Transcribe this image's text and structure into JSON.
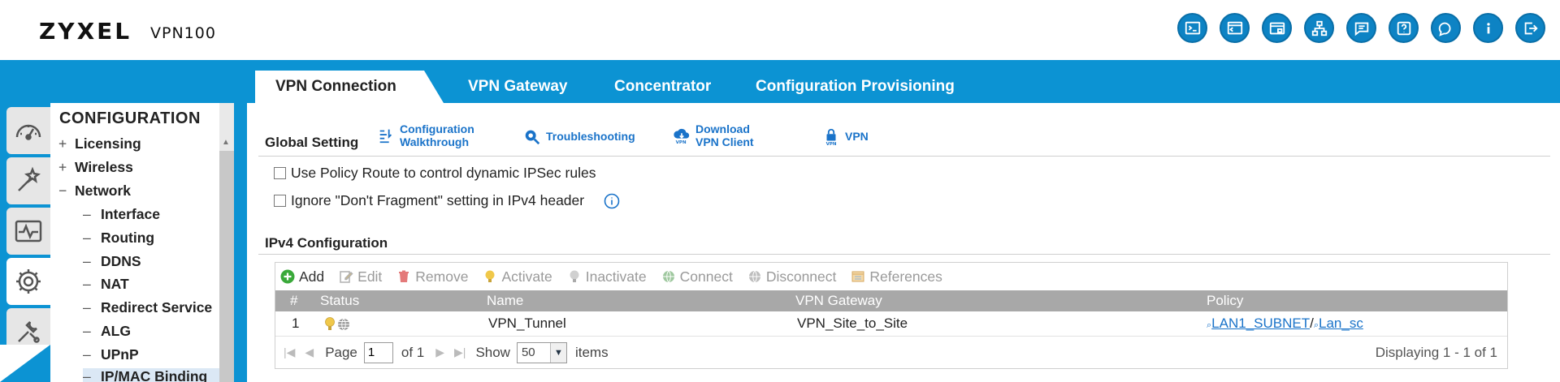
{
  "brand": {
    "logo": "ZYXEL",
    "model": "VPN100"
  },
  "header_icons": [
    "console-icon",
    "cli-icon",
    "window-icon",
    "sitemap-icon",
    "chat-icon",
    "help-icon",
    "cloud-chat-icon",
    "info-icon",
    "logout-icon"
  ],
  "tabs": [
    {
      "label": "VPN Connection",
      "active": true
    },
    {
      "label": "VPN Gateway"
    },
    {
      "label": "Concentrator"
    },
    {
      "label": "Configuration Provisioning"
    }
  ],
  "nav": {
    "title": "CONFIGURATION",
    "items": [
      {
        "mark": "+",
        "label": "Licensing"
      },
      {
        "mark": "+",
        "label": "Wireless"
      },
      {
        "mark": "−",
        "label": "Network"
      },
      {
        "mark": "–",
        "label": "Interface"
      },
      {
        "mark": "–",
        "label": "Routing"
      },
      {
        "mark": "–",
        "label": "DDNS"
      },
      {
        "mark": "–",
        "label": "NAT"
      },
      {
        "mark": "–",
        "label": "Redirect Service"
      },
      {
        "mark": "–",
        "label": "ALG"
      },
      {
        "mark": "–",
        "label": "UPnP"
      },
      {
        "mark": "–",
        "label": "IP/MAC Binding"
      }
    ]
  },
  "global_setting": {
    "title": "Global Setting",
    "links": {
      "walkthrough_1": "Configuration",
      "walkthrough_2": "Walkthrough",
      "troubleshooting": "Troubleshooting",
      "download_1": "Download",
      "download_2": "VPN Client",
      "vpn": "VPN"
    },
    "options": [
      {
        "label": "Use Policy Route to control dynamic IPSec rules",
        "checked": false
      },
      {
        "label": "Ignore \"Don't Fragment\" setting in IPv4 header",
        "checked": false
      }
    ]
  },
  "ipv4": {
    "title": "IPv4 Configuration",
    "toolbar": {
      "add": "Add",
      "edit": "Edit",
      "remove": "Remove",
      "activate": "Activate",
      "inactivate": "Inactivate",
      "connect": "Connect",
      "disconnect": "Disconnect",
      "references": "References"
    },
    "columns": {
      "num": "#",
      "status": "Status",
      "name": "Name",
      "gateway": "VPN Gateway",
      "policy": "Policy"
    },
    "rows": [
      {
        "num": "1",
        "name": "VPN_Tunnel",
        "gateway": "VPN_Site_to_Site",
        "policy_local": "LAN1_SUBNET",
        "policy_sep": "/",
        "policy_remote": "Lan_sc"
      }
    ],
    "pager": {
      "page_label": "Page",
      "page_value": "1",
      "of_label": "of 1",
      "show_label": "Show",
      "show_value": "50",
      "items_label": "items",
      "displaying": "Displaying 1 - 1 of 1"
    }
  },
  "colors": {
    "brand_blue": "#0c93d3",
    "link_blue": "#1a73c9",
    "header_gray": "#a8a8a8"
  }
}
